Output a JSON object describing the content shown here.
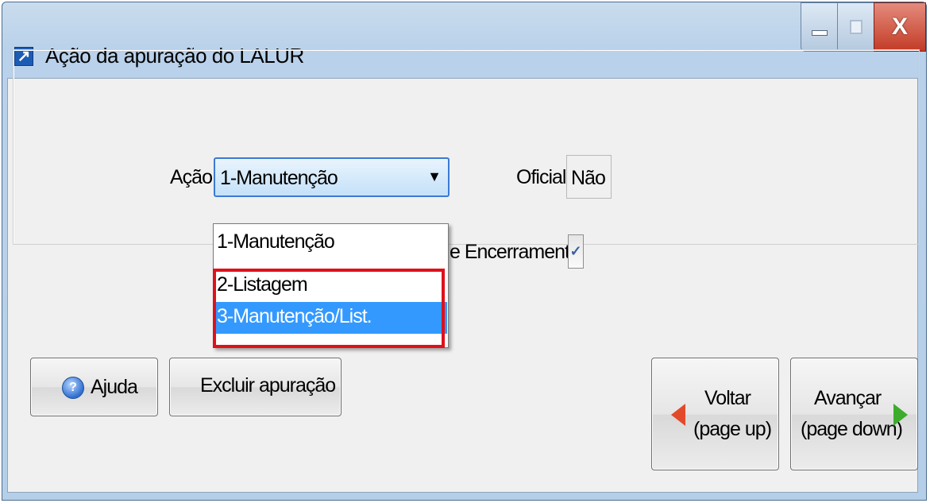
{
  "window": {
    "title": "Ação da apuração do LALUR",
    "controls": {
      "minimize": "minimize",
      "maximize": "maximize",
      "close": "X"
    }
  },
  "form": {
    "acao_label": "Ação",
    "acao_value": "1-Manutenção",
    "oficial_label": "Oficial",
    "oficial_value": "Não",
    "encerramento_label": "e Encerramento",
    "encerramento_checked": true
  },
  "dropdown": {
    "options": [
      "1-Manutenção",
      "2-Listagem",
      "3-Manutenção/List."
    ],
    "selected_index": 2
  },
  "buttons": {
    "help": {
      "label": "Ajuda"
    },
    "delete": {
      "label": "Excluir apuração"
    },
    "back": {
      "line1": "Voltar",
      "line2": "(page up)"
    },
    "next": {
      "line1": "Avançar",
      "line2": "(page down)"
    }
  },
  "icons": [
    "app-icon",
    "help-icon",
    "arrow-left-icon",
    "arrow-right-icon",
    "chevron-down-icon",
    "check-icon"
  ],
  "colors": {
    "highlight_border": "#e0101a",
    "selection": "#3399ff"
  }
}
